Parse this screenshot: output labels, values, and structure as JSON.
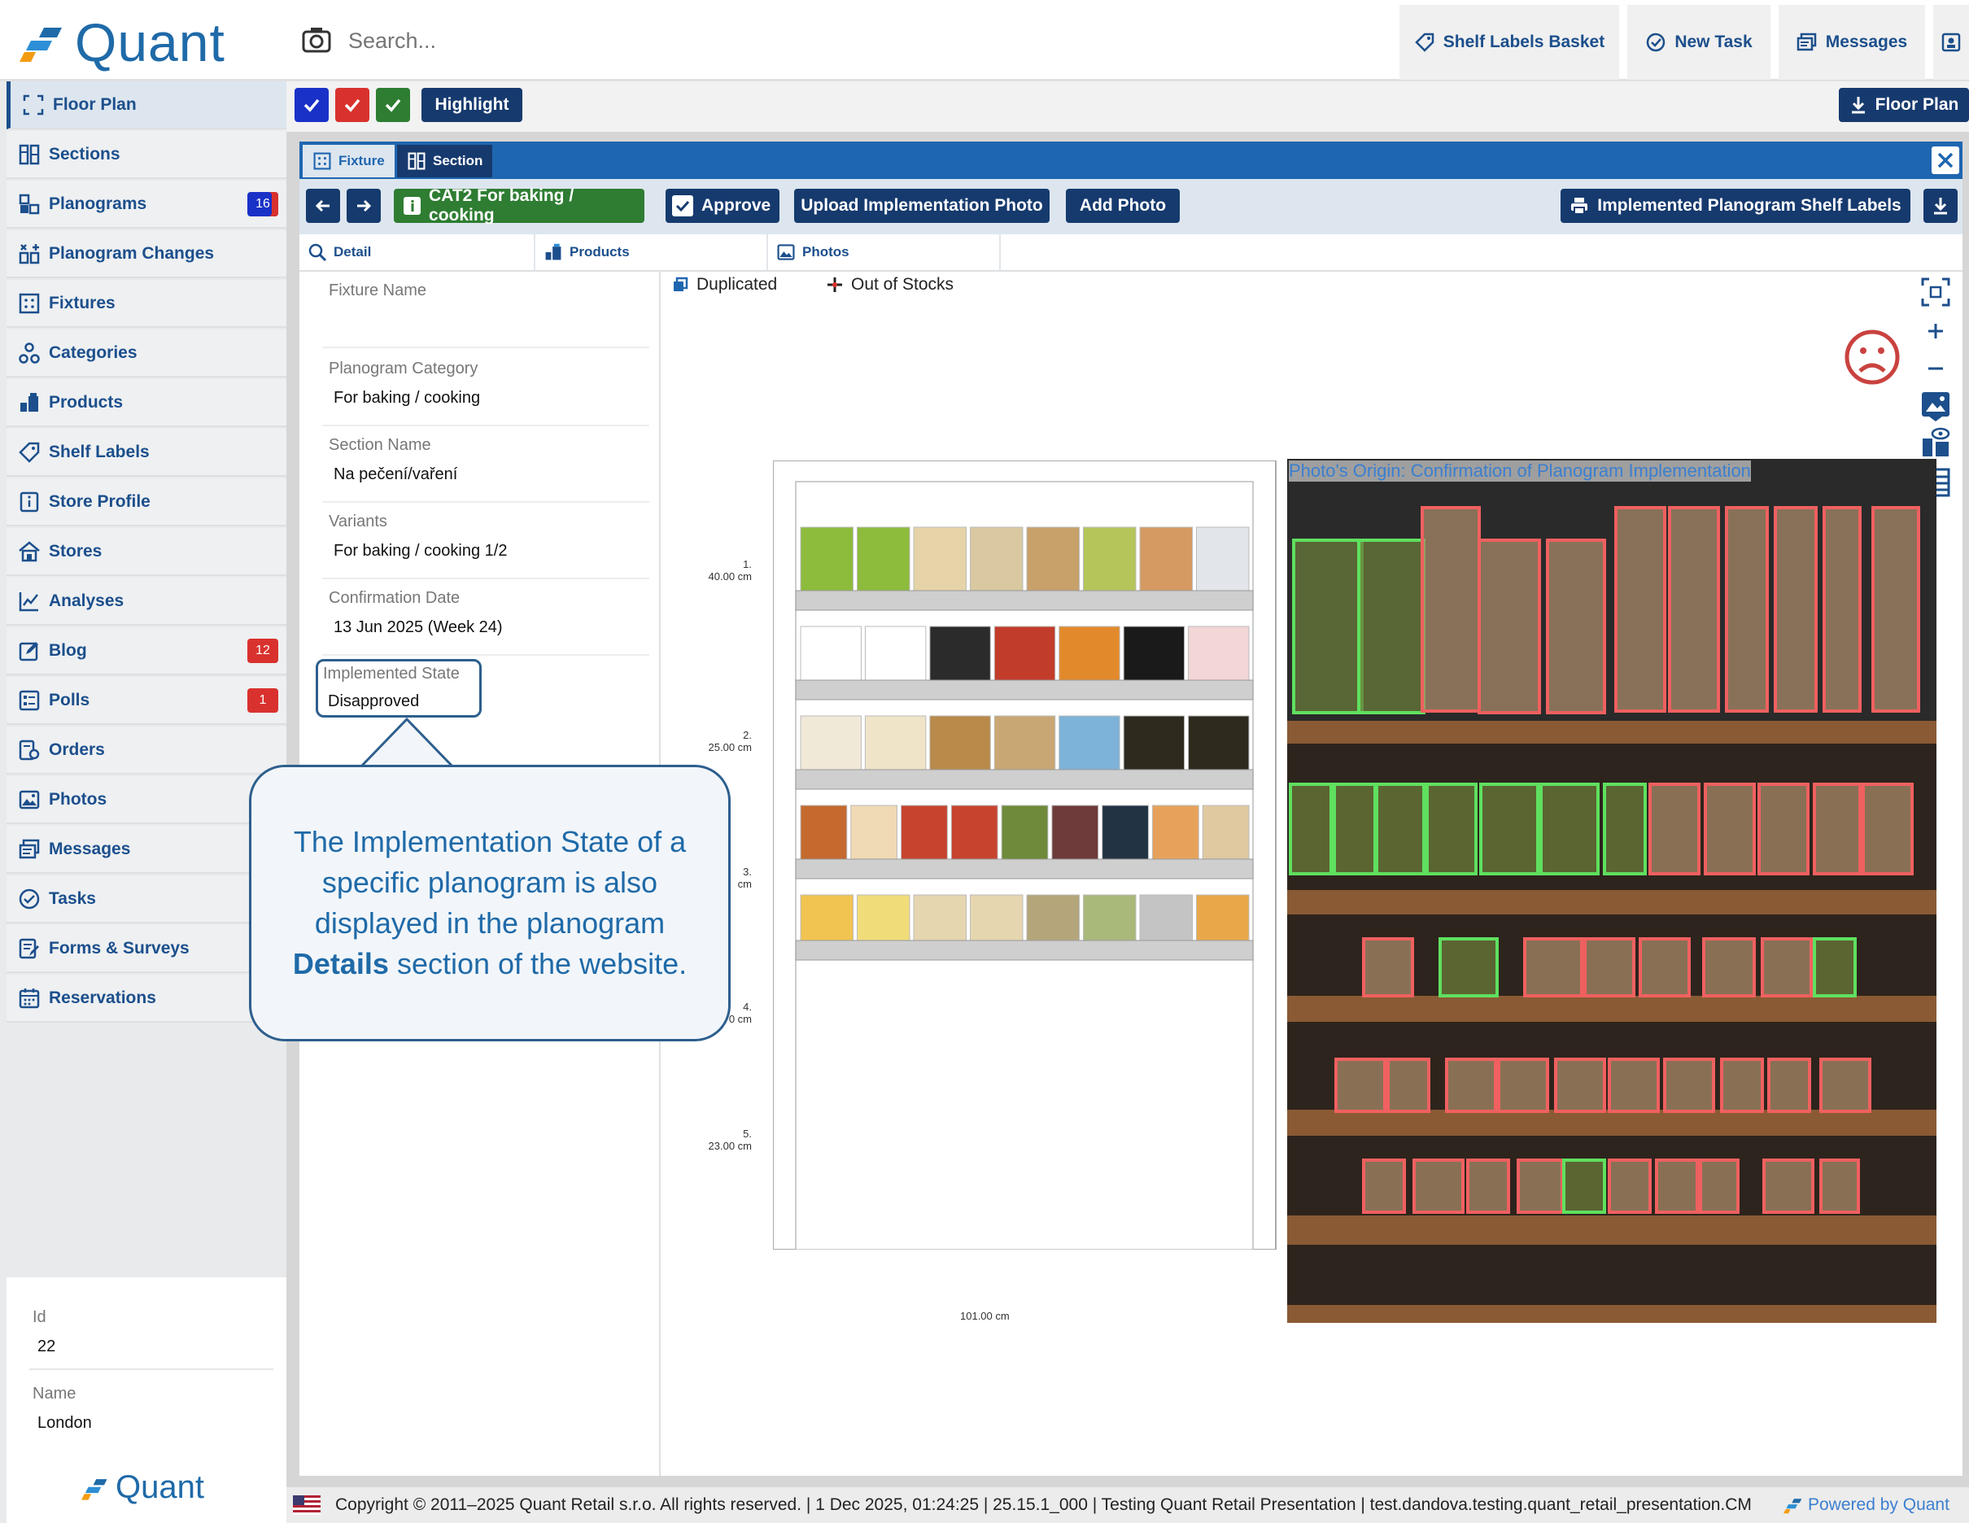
{
  "app": {
    "logo_text": "Quant",
    "footer_logo_text": "Quant"
  },
  "search": {
    "placeholder": "Search..."
  },
  "topbar": {
    "shelf_labels_basket": "Shelf Labels Basket",
    "new_task": "New Task",
    "messages": "Messages"
  },
  "sidebar": {
    "items": [
      {
        "label": "Floor Plan",
        "icon": "floor-plan-icon"
      },
      {
        "label": "Sections",
        "icon": "sections-icon"
      },
      {
        "label": "Planograms",
        "icon": "planograms-icon",
        "badge": "16"
      },
      {
        "label": "Planogram Changes",
        "icon": "planogram-changes-icon"
      },
      {
        "label": "Fixtures",
        "icon": "fixtures-icon"
      },
      {
        "label": "Categories",
        "icon": "categories-icon"
      },
      {
        "label": "Products",
        "icon": "products-icon"
      },
      {
        "label": "Shelf Labels",
        "icon": "shelf-labels-icon"
      },
      {
        "label": "Store Profile",
        "icon": "store-profile-icon"
      },
      {
        "label": "Stores",
        "icon": "stores-icon"
      },
      {
        "label": "Analyses",
        "icon": "analyses-icon"
      },
      {
        "label": "Blog",
        "icon": "blog-icon",
        "badge": "12"
      },
      {
        "label": "Polls",
        "icon": "polls-icon",
        "badge": "1"
      },
      {
        "label": "Orders",
        "icon": "orders-icon"
      },
      {
        "label": "Photos",
        "icon": "photos-icon"
      },
      {
        "label": "Messages",
        "icon": "messages-icon"
      },
      {
        "label": "Tasks",
        "icon": "tasks-icon"
      },
      {
        "label": "Forms & Surveys",
        "icon": "forms-icon"
      },
      {
        "label": "Reservations",
        "icon": "reservations-icon"
      }
    ],
    "info": {
      "id_label": "Id",
      "id_value": "22",
      "name_label": "Name",
      "name_value": "London"
    }
  },
  "toolbar1": {
    "highlight": "Highlight",
    "floor_plan": "Floor Plan",
    "colors": {
      "blue": "#1a31c8",
      "red": "#d9322e",
      "green": "#2e7d32"
    }
  },
  "tabs": {
    "fixture": "Fixture",
    "section": "Section"
  },
  "toolbar2": {
    "category": "CAT2 For baking / cooking",
    "approve": "Approve",
    "upload_photo": "Upload Implementation Photo",
    "add_photo": "Add Photo",
    "shelf_labels": "Implemented Planogram Shelf Labels"
  },
  "subtabs": {
    "detail": "Detail",
    "products": "Products",
    "photos": "Photos"
  },
  "detail": {
    "fixture_name_label": "Fixture Name",
    "fixture_name_value": "",
    "planogram_category_label": "Planogram Category",
    "planogram_category_value": "For baking / cooking",
    "section_name_label": "Section Name",
    "section_name_value": "Na pečení/vaření",
    "variants_label": "Variants",
    "variants_value": "For baking / cooking 1/2",
    "confirmation_date_label": "Confirmation Date",
    "confirmation_date_value": "13 Jun 2025 (Week 24)",
    "implemented_state_label": "Implemented State",
    "implemented_state_value": "Disapproved"
  },
  "callout": {
    "line_a": "The Implementation State of a specific planogram is also displayed in the planogram",
    "bold": "Details",
    "line_b": "section of the website."
  },
  "legend": {
    "duplicated": "Duplicated",
    "out_of_stocks": "Out of Stocks"
  },
  "planogram": {
    "shelves": [
      {
        "label": "1.",
        "height": "40.00 cm"
      },
      {
        "label": "2.",
        "height": "25.00 cm"
      },
      {
        "label": "3.",
        "height": "cm"
      },
      {
        "label": "4.",
        "height": "0 cm"
      },
      {
        "label": "5.",
        "height": "23.00 cm"
      }
    ],
    "width": "101.00 cm"
  },
  "photo": {
    "origin": "Photo's Origin: Confirmation of Planogram Implementation"
  },
  "footer": {
    "text": "Copyright © 2011–2025 Quant Retail s.r.o. All rights reserved. | 1 Dec 2025, 01:24:25 | 25.15.1_000 | Testing Quant Retail Presentation | test.dandova.testing.quant_retail_presentation.CM",
    "powered": "Powered by Quant"
  }
}
